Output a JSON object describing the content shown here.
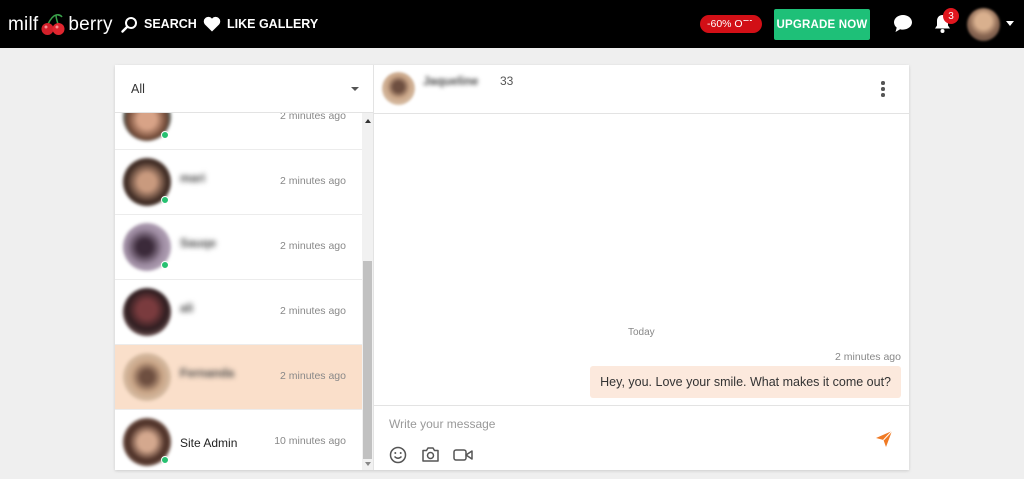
{
  "header": {
    "logo_left": "milf",
    "logo_right": "berry",
    "search_label": "SEARCH",
    "gallery_label": "LIKE GALLERY",
    "discount_label": "-60% OFF",
    "upgrade_label": "UPGRADE NOW",
    "notifications_count": "3",
    "colors": {
      "upgrade": "#1ec078",
      "discount": "#d20f16"
    }
  },
  "filter": {
    "selected": "All"
  },
  "conversations": [
    {
      "name": "",
      "time": "2 minutes ago"
    },
    {
      "name": "mari",
      "time": "2 minutes ago"
    },
    {
      "name": "Sauqe",
      "time": "2 minutes ago"
    },
    {
      "name": "ali",
      "time": "2 minutes ago"
    },
    {
      "name": "Fernanda",
      "time": "2 minutes ago"
    },
    {
      "name": "Site Admin",
      "time": "10 minutes ago"
    }
  ],
  "chat": {
    "name": "Jaqueline",
    "age": "33",
    "day_label": "Today",
    "messages": [
      {
        "time": "2 minutes ago",
        "text": "Hey, you. Love your smile. What makes it come out?"
      }
    ],
    "composer_placeholder": "Write your message"
  }
}
